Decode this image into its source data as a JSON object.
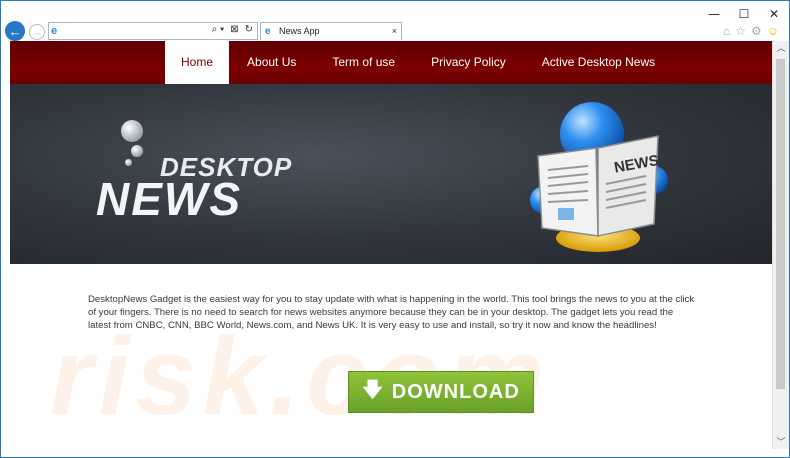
{
  "window": {
    "minimize_glyph": "—",
    "maximize_glyph": "☐",
    "close_glyph": "✕"
  },
  "browser": {
    "address_value": "",
    "address_tools": [
      "⌕ ▾",
      "⊠",
      "↻"
    ],
    "tab_title": "News App",
    "tab_close": "×",
    "right_icons": [
      "home-icon",
      "star-icon",
      "gear-icon",
      "smiley-icon"
    ]
  },
  "nav": {
    "items": [
      "Home",
      "About Us",
      "Term of use",
      "Privacy Policy",
      "Active Desktop News"
    ],
    "active": "Home"
  },
  "hero": {
    "logo_top": "DESKTOP",
    "logo_bottom": "NEWS",
    "paper_title": "NEWS"
  },
  "body": {
    "paragraph": "DesktopNews Gadget is the easiest way for you to stay update with what is happening in the world. This tool brings the news to you at the click of your fingers. There is no need to search for news websites anymore because they can be in your desktop. The gadget lets you read the latest from CNBC, CNN, BBC World, News.com, and News UK. It is very easy to use and install, so try it now and know the headlines!"
  },
  "download": {
    "label": "DOWNLOAD",
    "color": "#7cb32f"
  },
  "watermark": {
    "text": "risk.com"
  },
  "colors": {
    "nav_bg": "#7c0000",
    "frame_border": "#2b77c7"
  }
}
